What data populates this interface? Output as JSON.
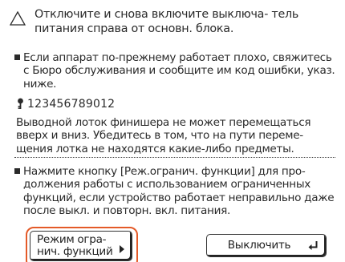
{
  "alert": {
    "icon": "warning-triangle-icon",
    "line1": "Отключите и снова включите выключа- тель",
    "line2": "питания справа от основн. блока."
  },
  "service": {
    "line1": "Если аппарат по-прежнему работает плохо, свяжитесь",
    "line2": "с Бюро обслуживания и сообщите им код ошибки, указ.",
    "line3": "ниже."
  },
  "error_code": {
    "icon": "key-icon",
    "value": "123456789012"
  },
  "finisher": {
    "line1": "Выводной лоток финишера не может перемещаться",
    "line2": "вверх и вниз. Убедитесь в том, что на пути переме-",
    "line3": "щения лотка не находятся какие-либо предметы."
  },
  "limited": {
    "line1": "Нажмите кнопку [Реж.огранич. функции] для про-",
    "line2": "должения работы с использованием ограниченных",
    "line3": "функций, если устройство работает неправильно даже",
    "line4": "после выкл. и повторн. вкл. питания."
  },
  "buttons": {
    "limited_mode_line1": "Режим огра-",
    "limited_mode_line2": "нич. функций",
    "power_off": "Выключить"
  },
  "colors": {
    "highlight": "#e45a28",
    "text": "#2a2a2a"
  }
}
